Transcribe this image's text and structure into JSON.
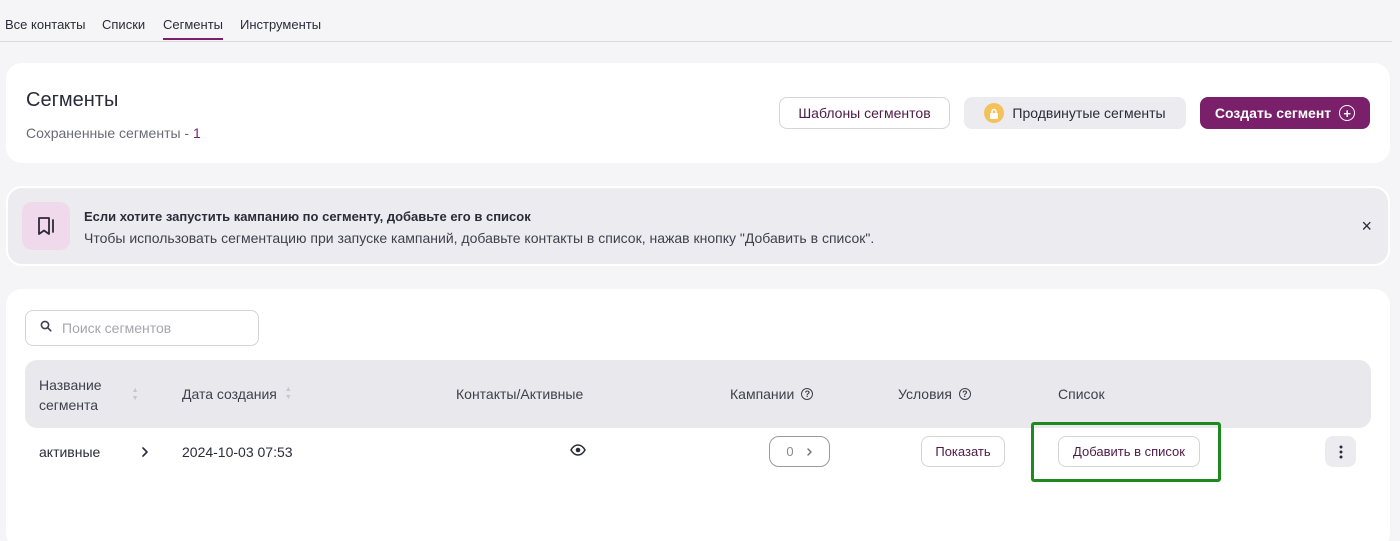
{
  "tabs": [
    {
      "label": "Все контакты"
    },
    {
      "label": "Списки"
    },
    {
      "label": "Сегменты",
      "active": true
    },
    {
      "label": "Инструменты"
    }
  ],
  "header": {
    "title": "Сегменты",
    "subtitle_text": "Сохраненные сегменты - ",
    "saved_count": "1",
    "templates_button": "Шаблоны сегментов",
    "advanced_button": "Продвинутые сегменты",
    "create_button": "Создать сегмент"
  },
  "banner": {
    "title": "Если хотите запустить кампанию по сегменту, добавьте его в список",
    "text": "Чтобы использовать сегментацию при запуске кампаний, добавьте контакты в список, нажав кнопку \"Добавить в список\".",
    "close": "×"
  },
  "search": {
    "placeholder": "Поиск сегментов",
    "value": ""
  },
  "table": {
    "headers": {
      "name_line1": "Название",
      "name_line2": "сегмента",
      "created": "Дата создания",
      "contacts": "Контакты/Активные",
      "campaigns": "Кампании",
      "conditions": "Условия",
      "list": "Список"
    },
    "rows": [
      {
        "name": "активные",
        "created": "2024-10-03 07:53",
        "campaigns": "0",
        "show_button": "Показать",
        "add_to_list_button": "Добавить в список"
      }
    ]
  },
  "colors": {
    "accent": "#7a1f6a",
    "highlight": "#1e8a1e",
    "lock": "#f5c15b"
  },
  "icons": [
    "lock-icon",
    "plus-circle-icon",
    "bookmark-icon",
    "close-icon",
    "search-icon",
    "sort-icon",
    "help-icon",
    "chevron-right-icon",
    "eye-icon",
    "kebab-icon"
  ]
}
